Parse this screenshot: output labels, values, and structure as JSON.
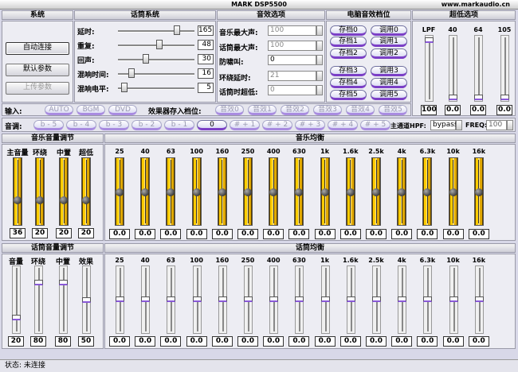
{
  "title": "MARK DSP5500",
  "url": "www.markaudio.cn",
  "headers": {
    "system": "系统",
    "mic_system": "话筒系统",
    "effects": "音效选项",
    "pc_memory": "电脑音效档位",
    "bass": "超低选项"
  },
  "system_buttons": [
    "自动连接",
    "默认参数",
    "上传参数"
  ],
  "mic_params": [
    {
      "label": "延时:",
      "value": "165",
      "pos": 0.8
    },
    {
      "label": "重复:",
      "value": "48",
      "pos": 0.55
    },
    {
      "label": "回声:",
      "value": "30",
      "pos": 0.35
    },
    {
      "label": "混响时间:",
      "value": "16",
      "pos": 0.15
    },
    {
      "label": "混响电平:",
      "value": "5",
      "pos": 0.05
    }
  ],
  "effects": [
    {
      "label": "音乐最大声:",
      "value": "100"
    },
    {
      "label": "话筒最大声:",
      "value": "100"
    },
    {
      "label": "防啸叫:",
      "value": "0"
    },
    {
      "label": "环绕延时:",
      "value": "21"
    },
    {
      "label": "话筒时超低:",
      "value": "0"
    }
  ],
  "memory": [
    [
      "存档0",
      "调用0"
    ],
    [
      "存档1",
      "调用1"
    ],
    [
      "存档2",
      "调用2"
    ],
    [
      "存档3",
      "调用3"
    ],
    [
      "存档4",
      "调用4"
    ],
    [
      "存档5",
      "调用5"
    ]
  ],
  "bass": {
    "labels": [
      "LPF",
      "40",
      "64",
      "105"
    ],
    "values": [
      "100",
      "0.0",
      "0.0",
      "0.0"
    ]
  },
  "input": {
    "label": "输入:",
    "options": [
      "AUTO",
      "BGM",
      "DVD"
    ]
  },
  "effect_store": {
    "label": "效果器存入档位:",
    "options": [
      "音效0",
      "音效1",
      "音效2",
      "音效3",
      "音效4",
      "音效5"
    ]
  },
  "key": {
    "label": "音调:",
    "options": [
      "b - 5",
      "b - 4",
      "b - 3",
      "b - 2",
      "b - 1",
      "0",
      "# + 1",
      "# + 2",
      "# + 3",
      "# + 4",
      "# + 5"
    ]
  },
  "hpf": {
    "label": "主通道HPF:",
    "value": "bypass",
    "freq_label": "FREQ:",
    "freq_value": "100"
  },
  "music_vol": {
    "title": "音乐音量调节",
    "labels": [
      "主音量",
      "环绕",
      "中置",
      "超低"
    ],
    "values": [
      "36",
      "20",
      "20",
      "20"
    ]
  },
  "music_eq": {
    "title": "音乐均衡",
    "bands": [
      "25",
      "40",
      "63",
      "100",
      "160",
      "250",
      "400",
      "630",
      "1k",
      "1.6k",
      "2.5k",
      "4k",
      "6.3k",
      "10k",
      "16k"
    ],
    "value": "0.0"
  },
  "mic_vol": {
    "title": "话筒音量调节",
    "labels": [
      "音量",
      "环绕",
      "中置",
      "效果"
    ],
    "values": [
      "20",
      "80",
      "80",
      "50"
    ],
    "positions": [
      0.2,
      0.8,
      0.8,
      0.5
    ]
  },
  "mic_eq": {
    "title": "话筒均衡",
    "bands": [
      "25",
      "40",
      "63",
      "100",
      "160",
      "250",
      "400",
      "630",
      "1k",
      "1.6k",
      "2.5k",
      "4k",
      "6.3k",
      "10k",
      "16k"
    ],
    "value": "0.0"
  },
  "status": "状态: 未连接"
}
